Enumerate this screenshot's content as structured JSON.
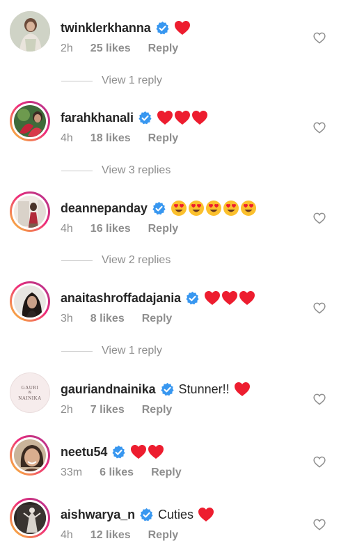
{
  "colors": {
    "text": "#262626",
    "muted": "#8e8e8e",
    "verified_blue": "#3897f0",
    "heart_red": "#ed1d2f",
    "story_ring": [
      "#f9ce34",
      "#ee2a7b",
      "#c13584"
    ]
  },
  "comments": [
    {
      "username": "twinklerkhanna",
      "verified": true,
      "text": "",
      "emojis": [
        "red-heart"
      ],
      "time": "2h",
      "likes": "25 likes",
      "reply_label": "Reply",
      "view_replies": "View 1 reply",
      "avatar_ring": false
    },
    {
      "username": "farahkhanali",
      "verified": true,
      "text": "",
      "emojis": [
        "red-heart",
        "red-heart",
        "red-heart"
      ],
      "time": "4h",
      "likes": "18 likes",
      "reply_label": "Reply",
      "view_replies": "View 3 replies",
      "avatar_ring": true
    },
    {
      "username": "deannepanday",
      "verified": true,
      "text": "",
      "emojis": [
        "heart-eyes",
        "heart-eyes",
        "heart-eyes",
        "heart-eyes",
        "heart-eyes"
      ],
      "time": "4h",
      "likes": "16 likes",
      "reply_label": "Reply",
      "view_replies": "View 2 replies",
      "avatar_ring": true
    },
    {
      "username": "anaitashroffadajania",
      "verified": true,
      "text": "",
      "emojis": [
        "red-heart",
        "red-heart",
        "red-heart"
      ],
      "time": "3h",
      "likes": "8 likes",
      "reply_label": "Reply",
      "view_replies": "View 1 reply",
      "avatar_ring": true
    },
    {
      "username": "gauriandnainika",
      "verified": true,
      "text": "Stunner!!",
      "emojis": [
        "red-heart"
      ],
      "time": "2h",
      "likes": "7 likes",
      "reply_label": "Reply",
      "view_replies": "",
      "avatar_ring": false,
      "avatar_logo_lines": [
        "GAURI",
        "&",
        "NAINIKA"
      ]
    },
    {
      "username": "neetu54",
      "verified": true,
      "text": "",
      "emojis": [
        "red-heart",
        "red-heart"
      ],
      "time": "33m",
      "likes": "6 likes",
      "reply_label": "Reply",
      "view_replies": "",
      "avatar_ring": true
    },
    {
      "username": "aishwarya_n",
      "verified": true,
      "text": "Cuties",
      "emojis": [
        "red-heart"
      ],
      "time": "4h",
      "likes": "12 likes",
      "reply_label": "Reply",
      "view_replies": "",
      "avatar_ring": true
    }
  ]
}
